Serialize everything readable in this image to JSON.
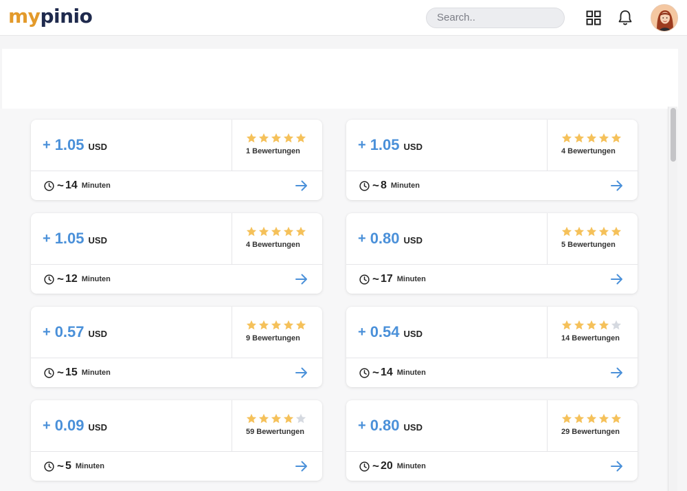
{
  "header": {
    "logo_part1": "my",
    "logo_part2": "pinio",
    "search_placeholder": "Search.."
  },
  "icons": {
    "grid": "grid-icon",
    "bell": "bell-icon",
    "avatar": "user-avatar",
    "clock": "clock-icon",
    "arrow": "arrow-right-icon",
    "star": "star-icon"
  },
  "colors": {
    "accent": "#4a90d9",
    "star_filled": "#f5c15a",
    "star_empty": "#d5d9e0",
    "logo_my": "#e39a2b",
    "logo_pinio": "#1f2a4d"
  },
  "tasks": [
    {
      "plus": "+",
      "amount": "1.05",
      "currency": "USD",
      "rating": 5,
      "reviews": "1 Bewertungen",
      "tilde": "~",
      "minutes": "14",
      "min_label": "Minuten"
    },
    {
      "plus": "+",
      "amount": "1.05",
      "currency": "USD",
      "rating": 5,
      "reviews": "4 Bewertungen",
      "tilde": "~",
      "minutes": "8",
      "min_label": "Minuten"
    },
    {
      "plus": "+",
      "amount": "1.05",
      "currency": "USD",
      "rating": 5,
      "reviews": "4 Bewertungen",
      "tilde": "~",
      "minutes": "12",
      "min_label": "Minuten"
    },
    {
      "plus": "+",
      "amount": "0.80",
      "currency": "USD",
      "rating": 5,
      "reviews": "5 Bewertungen",
      "tilde": "~",
      "minutes": "17",
      "min_label": "Minuten"
    },
    {
      "plus": "+",
      "amount": "0.57",
      "currency": "USD",
      "rating": 5,
      "reviews": "9 Bewertungen",
      "tilde": "~",
      "minutes": "15",
      "min_label": "Minuten"
    },
    {
      "plus": "+",
      "amount": "0.54",
      "currency": "USD",
      "rating": 4,
      "reviews": "14 Bewertungen",
      "tilde": "~",
      "minutes": "14",
      "min_label": "Minuten"
    },
    {
      "plus": "+",
      "amount": "0.09",
      "currency": "USD",
      "rating": 4,
      "reviews": "59 Bewertungen",
      "tilde": "~",
      "minutes": "5",
      "min_label": "Minuten"
    },
    {
      "plus": "+",
      "amount": "0.80",
      "currency": "USD",
      "rating": 5,
      "reviews": "29 Bewertungen",
      "tilde": "~",
      "minutes": "20",
      "min_label": "Minuten"
    }
  ]
}
